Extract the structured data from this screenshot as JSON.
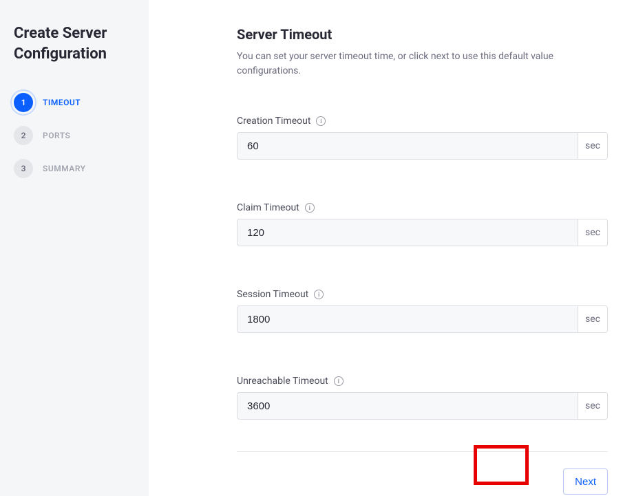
{
  "sidebar": {
    "title": "Create Server Configuration",
    "steps": [
      {
        "num": "1",
        "label": "TIMEOUT"
      },
      {
        "num": "2",
        "label": "PORTS"
      },
      {
        "num": "3",
        "label": "SUMMARY"
      }
    ]
  },
  "main": {
    "title": "Server Timeout",
    "description": "You can set your server timeout time, or click next to use this default value configurations.",
    "fields": [
      {
        "label": "Creation Timeout",
        "value": "60",
        "unit": "sec"
      },
      {
        "label": "Claim Timeout",
        "value": "120",
        "unit": "sec"
      },
      {
        "label": "Session Timeout",
        "value": "1800",
        "unit": "sec"
      },
      {
        "label": "Unreachable Timeout",
        "value": "3600",
        "unit": "sec"
      }
    ],
    "next_label": "Next"
  }
}
